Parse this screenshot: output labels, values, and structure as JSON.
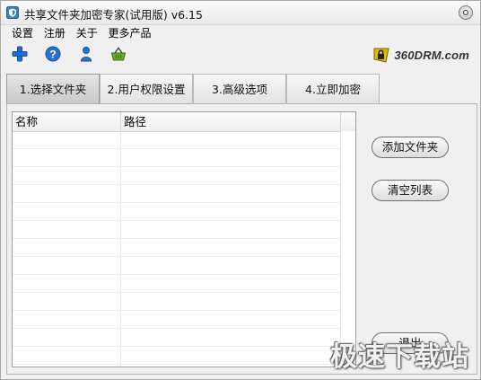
{
  "window": {
    "title": "共享文件夹加密专家(试用版) v6.15"
  },
  "menu": [
    "设置",
    "注册",
    "关于",
    "更多产品"
  ],
  "toolbar": {
    "icons": [
      "plus-icon",
      "help-icon",
      "user-icon",
      "basket-icon"
    ]
  },
  "brand": {
    "text": "360DRM.com"
  },
  "tabs": [
    {
      "label": "1.选择文件夹",
      "active": true
    },
    {
      "label": "2.用户权限设置",
      "active": false
    },
    {
      "label": "3.高级选项",
      "active": false
    },
    {
      "label": "4.立即加密",
      "active": false
    }
  ],
  "list": {
    "columns": [
      "名称",
      "路径"
    ],
    "rows": []
  },
  "buttons": {
    "add_folder": "添加文件夹",
    "clear_list": "清空列表",
    "exit": "退出"
  },
  "watermark": "极速下载站",
  "colors": {
    "accent_blue": "#1f6fd1",
    "icon_green": "#6aa82a",
    "brand_yellow": "#e8b800"
  }
}
